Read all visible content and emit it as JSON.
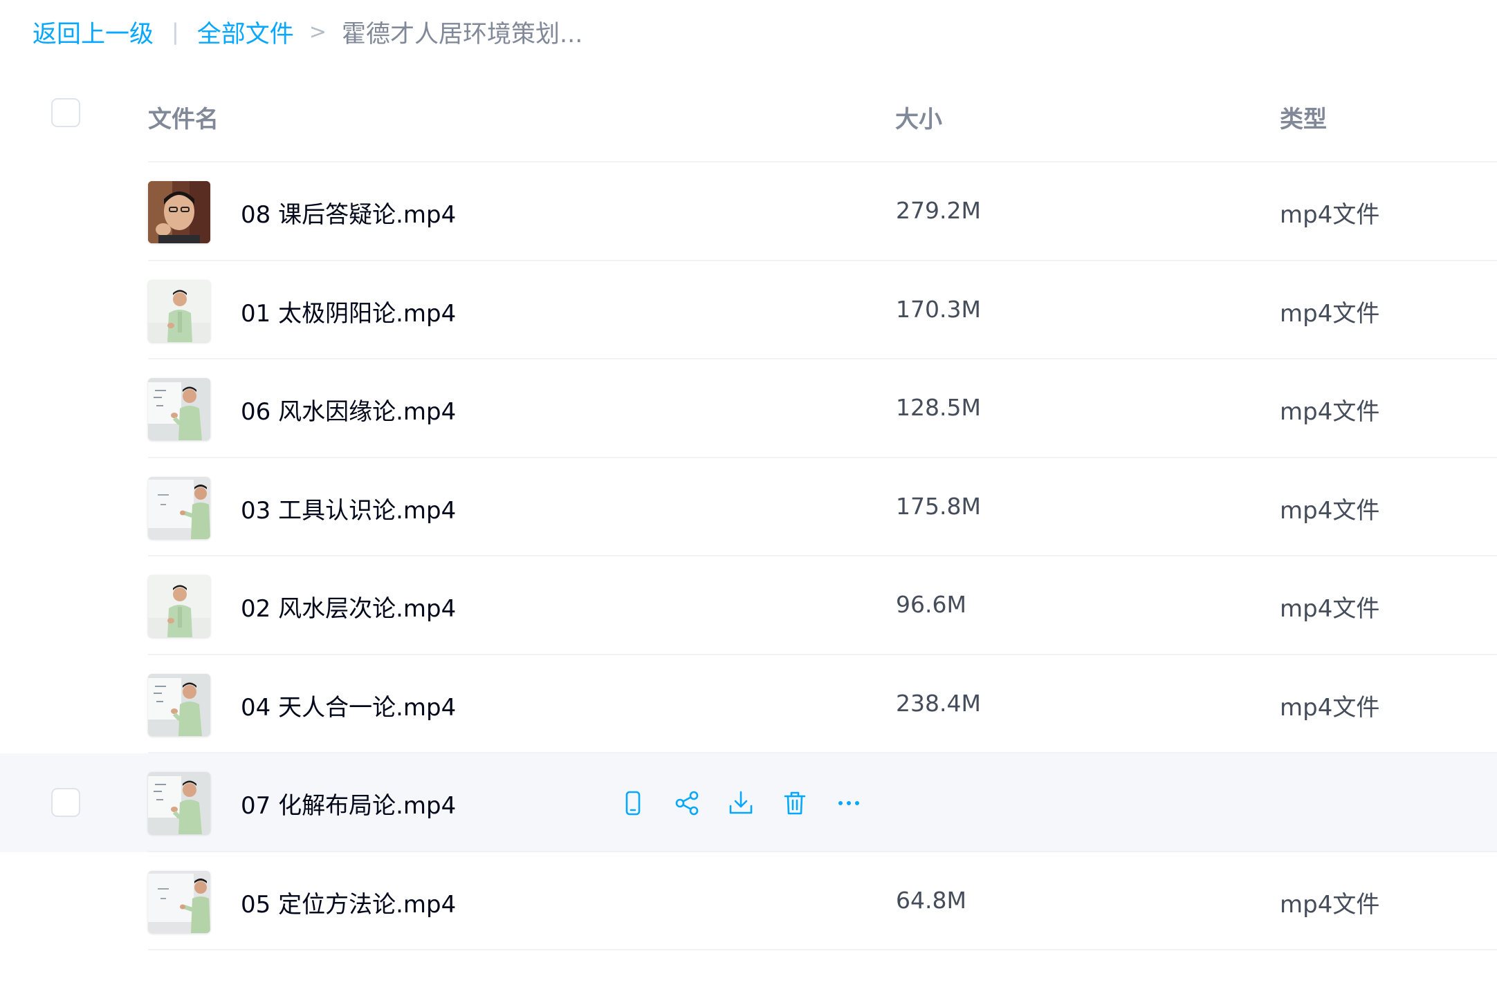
{
  "breadcrumb": {
    "back": "返回上一级",
    "separator": "|",
    "root": "全部文件",
    "arrow": ">",
    "current": "霍德才人居环境策划..."
  },
  "columns": {
    "name": "文件名",
    "size": "大小",
    "type": "类型"
  },
  "colors": {
    "accent": "#06a7ff",
    "hover_row": "#f5f7fa",
    "text_primary": "#03081a",
    "text_secondary": "#454d5a",
    "text_muted": "#818999"
  },
  "files": [
    {
      "name": "08 课后答疑论.mp4",
      "size": "279.2M",
      "type": "mp4文件",
      "thumb": "closeup"
    },
    {
      "name": "01 太极阴阳论.mp4",
      "size": "170.3M",
      "type": "mp4文件",
      "thumb": "standing"
    },
    {
      "name": "06 风水因缘论.mp4",
      "size": "128.5M",
      "type": "mp4文件",
      "thumb": "whiteboard-left"
    },
    {
      "name": "03 工具认识论.mp4",
      "size": "175.8M",
      "type": "mp4文件",
      "thumb": "whiteboard-right"
    },
    {
      "name": "02 风水层次论.mp4",
      "size": "96.6M",
      "type": "mp4文件",
      "thumb": "standing"
    },
    {
      "name": "04 天人合一论.mp4",
      "size": "238.4M",
      "type": "mp4文件",
      "thumb": "whiteboard-left"
    },
    {
      "name": "07 化解布局论.mp4",
      "size": "",
      "type": "",
      "thumb": "whiteboard-left",
      "hovered": true
    },
    {
      "name": "05 定位方法论.mp4",
      "size": "64.8M",
      "type": "mp4文件",
      "thumb": "whiteboard-right"
    }
  ],
  "row_actions": [
    {
      "name": "phone-icon"
    },
    {
      "name": "share-icon"
    },
    {
      "name": "download-icon"
    },
    {
      "name": "delete-icon"
    },
    {
      "name": "more-icon"
    }
  ]
}
